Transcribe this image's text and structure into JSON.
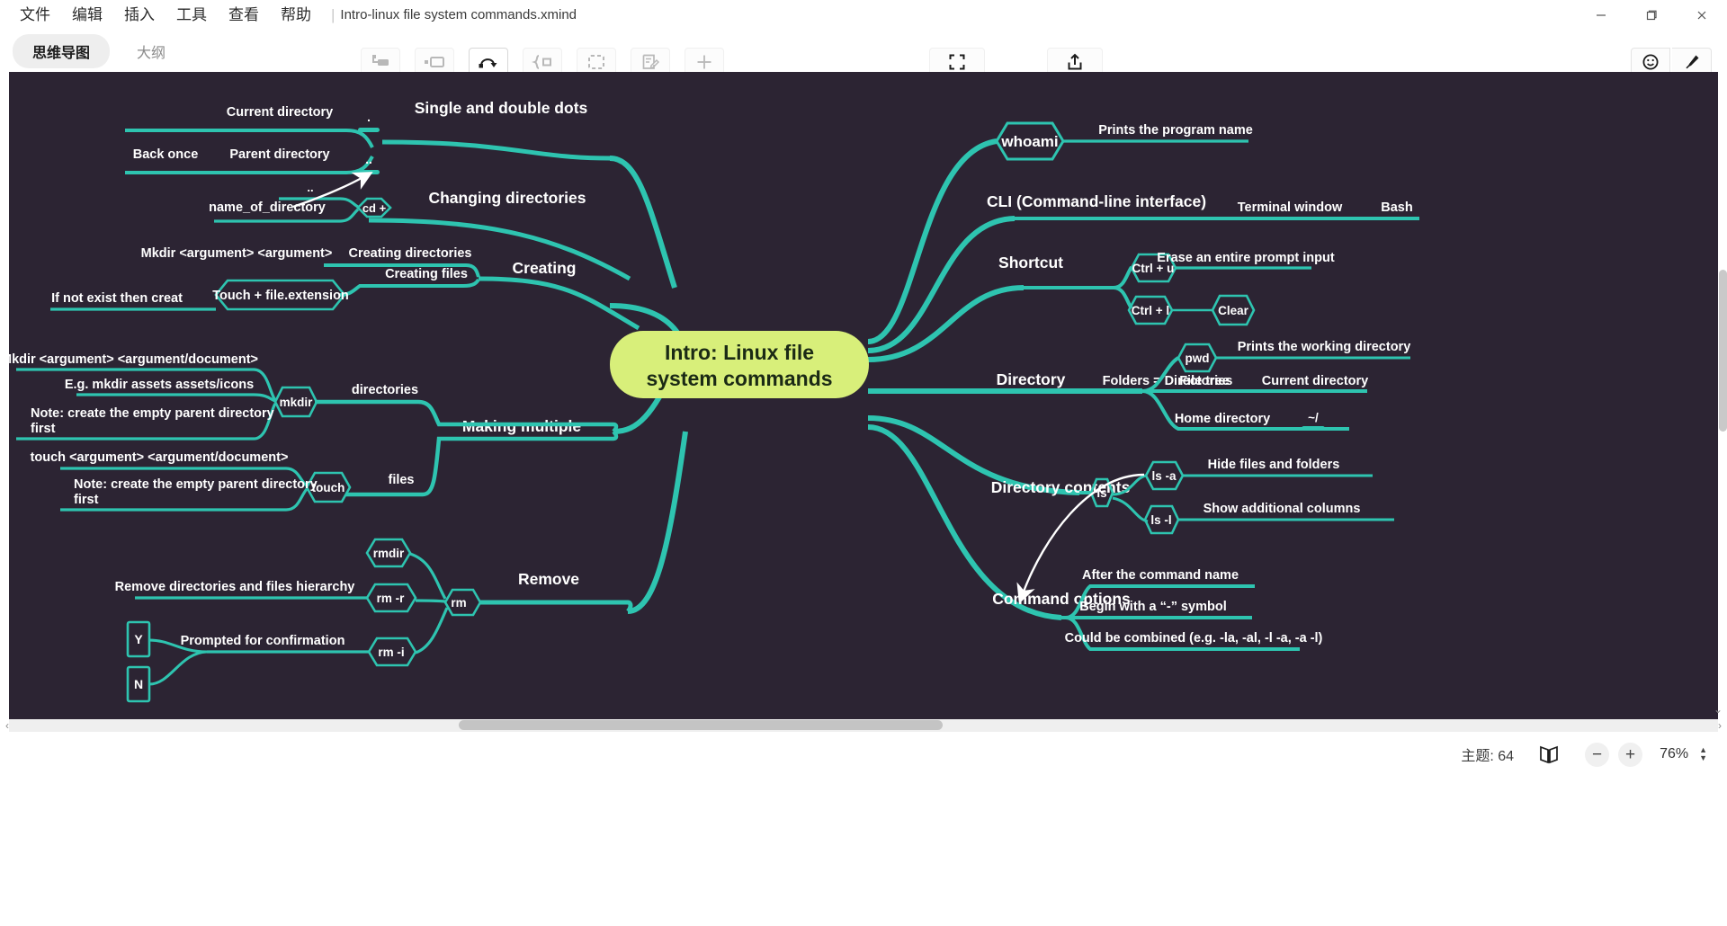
{
  "window": {
    "minimize_label": "—",
    "maximize_label": "❐",
    "close_label": "✕"
  },
  "menubar": {
    "items": [
      "文件",
      "编辑",
      "插入",
      "工具",
      "查看",
      "帮助"
    ],
    "separator": "|",
    "document_title": "Intro-linux file system commands.xmind"
  },
  "view_tabs": [
    {
      "label": "思维导图",
      "active": true
    },
    {
      "label": "大纲",
      "active": false
    }
  ],
  "toolbar": {
    "center_tools": [
      {
        "label": "主题",
        "icon": "topic-icon",
        "enabled": false
      },
      {
        "label": "子主题",
        "icon": "subtopic-icon",
        "enabled": false
      },
      {
        "label": "联系",
        "icon": "relationship-icon",
        "enabled": true
      },
      {
        "label": "概要",
        "icon": "summary-icon",
        "enabled": false
      },
      {
        "label": "外框",
        "icon": "boundary-icon",
        "enabled": false
      },
      {
        "label": "笔记",
        "icon": "notes-icon",
        "enabled": false
      },
      {
        "label": "插入",
        "icon": "plus-icon",
        "enabled": false
      }
    ],
    "zen_tools": [
      {
        "label": "ZEN",
        "icon": "fullscreen-icon",
        "enabled": true
      },
      {
        "label": "分享",
        "icon": "share-icon",
        "enabled": true
      }
    ],
    "right_tools": [
      {
        "label": "图标",
        "icon": "emoji-icon",
        "enabled": true
      },
      {
        "label": "格式",
        "icon": "brush-icon",
        "enabled": true
      }
    ]
  },
  "statusbar": {
    "topic_count_label": "主题: 64",
    "map_mode_icon": "map-book-icon",
    "zoom_out_label": "−",
    "zoom_in_label": "+",
    "zoom_level": "76%",
    "stepper_up": "▲",
    "stepper_down": "▼"
  },
  "colors": {
    "canvas_bg": "#2c2433",
    "branch": "#2ec4b0",
    "central_fill": "#d8ef7a",
    "central_text": "#1b2a15",
    "node_text": "#ffffff",
    "relationship": "#ffffff"
  },
  "mindmap": {
    "central_topic": {
      "line1": "Intro: Linux file",
      "line2": "system commands"
    },
    "left_branches": [
      {
        "name": "single-and-double-dots",
        "label": "Single and double dots",
        "children": [
          {
            "label": ".",
            "shape": "hexagon",
            "children": [
              {
                "label": "Current directory",
                "children": []
              }
            ]
          },
          {
            "label": "..",
            "shape": "hexagon",
            "children": [
              {
                "label": "Parent directory",
                "children": [
                  {
                    "label": "Back once"
                  }
                ]
              }
            ]
          }
        ]
      },
      {
        "name": "changing-directories",
        "label": "Changing directories",
        "children": [
          {
            "label": "cd +",
            "shape": "hexagon",
            "children": [
              {
                "label": "..",
                "children": []
              },
              {
                "label": "name_of_directory",
                "children": []
              }
            ]
          }
        ]
      },
      {
        "name": "creating",
        "label": "Creating",
        "children": [
          {
            "label": "Creating directories",
            "children": [
              {
                "label": "Mkdir <argument> <argument>"
              }
            ]
          },
          {
            "label": "Creating files",
            "children": [
              {
                "label": "Touch + file.extension",
                "shape": "hexagon",
                "children": [
                  {
                    "label": "If not exist then creat"
                  }
                ]
              }
            ]
          }
        ]
      },
      {
        "name": "making-multiple",
        "label": "Making multiple",
        "children": [
          {
            "label": "directories",
            "children": [
              {
                "label": "mkdir",
                "shape": "hexagon",
                "children": [
                  {
                    "label": "Mkdir <argument> <argument/document>"
                  },
                  {
                    "label": "E.g. mkdir assets assets/icons"
                  },
                  {
                    "label": "Note: create the empty parent directory first"
                  }
                ]
              }
            ]
          },
          {
            "label": "files",
            "children": [
              {
                "label": "touch",
                "shape": "hexagon",
                "children": [
                  {
                    "label": "touch <argument> <argument/document>"
                  },
                  {
                    "label": "Note: create the empty parent directory first"
                  }
                ]
              }
            ]
          }
        ]
      },
      {
        "name": "remove",
        "label": "Remove",
        "children": [
          {
            "label": "rm",
            "shape": "hexagon",
            "children": [
              {
                "label": "rmdir",
                "shape": "hexagon",
                "children": []
              },
              {
                "label": "rm -r",
                "shape": "hexagon",
                "children": [
                  {
                    "label": "Remove directories and files hierarchy"
                  }
                ]
              },
              {
                "label": "rm -i",
                "shape": "hexagon",
                "children": [
                  {
                    "label": "Prompted for confirmation",
                    "children": [
                      {
                        "label": "Y",
                        "shape": "rect"
                      },
                      {
                        "label": "N",
                        "shape": "rect"
                      }
                    ]
                  }
                ]
              }
            ]
          }
        ]
      }
    ],
    "right_branches": [
      {
        "name": "whoami",
        "label": "whoami",
        "shape": "hexagon",
        "children": [
          {
            "label": "Prints the program name"
          }
        ]
      },
      {
        "name": "cli",
        "label": "CLI (Command-line interface)",
        "children": [
          {
            "label": "Terminal window",
            "children": [
              {
                "label": "Bash"
              }
            ]
          }
        ]
      },
      {
        "name": "shortcut",
        "label": "Shortcut",
        "children": [
          {
            "label": "Ctrl + u",
            "shape": "hexagon",
            "children": [
              {
                "label": "Erase an entire prompt input"
              }
            ]
          },
          {
            "label": "Ctrl + l",
            "shape": "hexagon",
            "children": [
              {
                "label": "Clear",
                "shape": "hexagon"
              }
            ]
          }
        ]
      },
      {
        "name": "directory",
        "label": "Directory",
        "children": [
          {
            "label": "Folders = Directories",
            "children": [
              {
                "label": "pwd",
                "shape": "hexagon",
                "children": [
                  {
                    "label": "Prints the working directory"
                  }
                ]
              },
              {
                "label": "File tree",
                "children": [
                  {
                    "label": "Current directory"
                  }
                ]
              },
              {
                "label": "Home directory",
                "children": [
                  {
                    "label": "~/",
                    "shape": "hexagon"
                  }
                ]
              }
            ]
          }
        ]
      },
      {
        "name": "directory-contents",
        "label": "Directory contents",
        "children": [
          {
            "label": "ls",
            "shape": "hexagon",
            "children": [
              {
                "label": "ls -a",
                "shape": "hexagon",
                "children": [
                  {
                    "label": "Hide files and folders"
                  }
                ]
              },
              {
                "label": "ls -l",
                "shape": "hexagon",
                "children": [
                  {
                    "label": "Show additional columns"
                  }
                ]
              }
            ]
          }
        ]
      },
      {
        "name": "command-options",
        "label": "Command options",
        "children": [
          {
            "label": "After the command name"
          },
          {
            "label": "Begin with a “-” symbol"
          },
          {
            "label": "Could be combined (e.g. -la, -al, -l -a, -a -l)"
          }
        ]
      }
    ],
    "relationships": [
      {
        "from": "cd-dotdot-node",
        "to": "dotdot-node",
        "style": "curved-arrow"
      },
      {
        "from": "ls-a-node",
        "to": "command-options",
        "style": "curved-arrow"
      }
    ]
  }
}
